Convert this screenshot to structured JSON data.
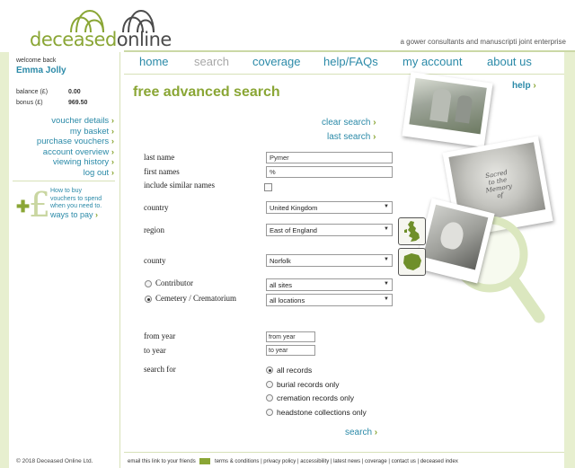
{
  "header": {
    "logo_part1": "deceased",
    "logo_part2": "online",
    "tagline": "a gower consultants and manuscripti joint enterprise"
  },
  "nav": {
    "items": [
      {
        "label": "home"
      },
      {
        "label": "search"
      },
      {
        "label": "coverage"
      },
      {
        "label": "help/FAQs"
      },
      {
        "label": "my account"
      },
      {
        "label": "about us"
      }
    ]
  },
  "sidebar": {
    "welcome": "welcome back",
    "username": "Emma Jolly",
    "balance_label": "balance (£)",
    "balance_value": "0.00",
    "bonus_label": "bonus (£)",
    "bonus_value": "969.50",
    "links": [
      {
        "label": "voucher details"
      },
      {
        "label": "my basket"
      },
      {
        "label": "purchase vouchers"
      },
      {
        "label": "account overview"
      },
      {
        "label": "viewing history"
      },
      {
        "label": "log out"
      }
    ],
    "pay_text1": "How to buy",
    "pay_text2": "vouchers to spend",
    "pay_text3": "when you need to.",
    "pay_link": "ways to pay",
    "copyright": "© 2018 Deceased Online Ltd."
  },
  "main": {
    "title": "free advanced search",
    "help": "help",
    "clear_search": "clear search",
    "last_search": "last search",
    "labels": {
      "last_name": "last name",
      "first_names": "first names",
      "include_similar": "include similar names",
      "country": "country",
      "region": "region",
      "county": "county",
      "contributor": "Contributor",
      "cemetery": "Cemetery / Crematorium",
      "from_year": "from year",
      "to_year": "to year",
      "search_for": "search for"
    },
    "values": {
      "last_name": "Pymer",
      "first_names": "%",
      "country": "United Kingdom",
      "region": "East of England",
      "county": "Norfolk",
      "contributor": "all sites",
      "cemetery": "all locations",
      "from_year": "from year",
      "to_year": "to year"
    },
    "search_options": [
      {
        "label": "all records"
      },
      {
        "label": "burial records only"
      },
      {
        "label": "cremation records only"
      },
      {
        "label": "headstone collections only"
      }
    ],
    "search_button": "search"
  },
  "photo_text": {
    "line1": "Sacred",
    "line2": "to the Memory",
    "line3": "of"
  },
  "footer": {
    "email_link": "email this link to your friends",
    "links": "terms & conditions | privacy policy | accessibility | latest news | coverage | contact us | deceased index"
  },
  "colors": {
    "green": "#8aa635",
    "blue": "#2b8aa8",
    "pale_green": "#e7efcf"
  }
}
